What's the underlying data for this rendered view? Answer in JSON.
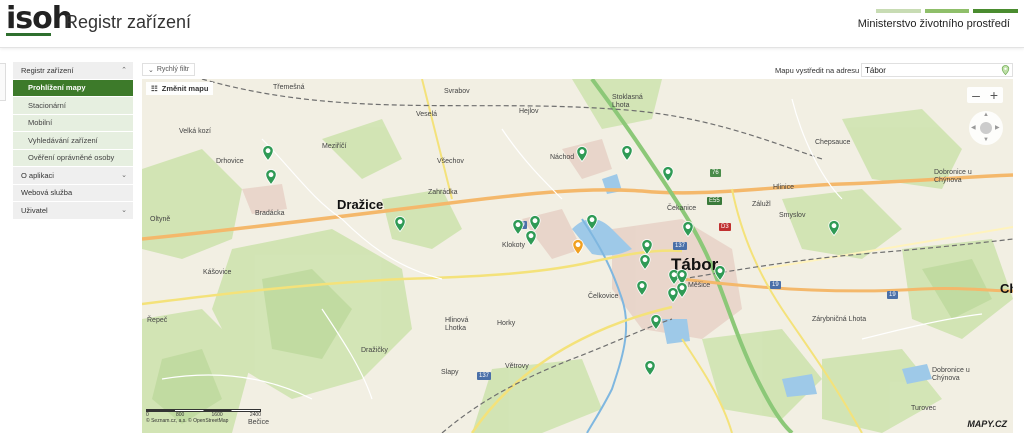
{
  "header": {
    "logo": "isoh",
    "title": "Registr zařízení",
    "ministry": "Ministerstvo životního prostředí",
    "ministry_bar_colors": [
      "#c8dcb4",
      "#8fbf6a",
      "#4a8c2f"
    ]
  },
  "sidebar": {
    "section_registr": "Registr zařízení",
    "sub_items": [
      {
        "label": "Prohlížení mapy",
        "active": true
      },
      {
        "label": "Stacionární"
      },
      {
        "label": "Mobilní"
      },
      {
        "label": "Vyhledávání zařízení"
      },
      {
        "label": "Ověření oprávněné osoby"
      }
    ],
    "about": "O aplikaci",
    "webservice": "Webová služba",
    "user": "Uživatel"
  },
  "toolbar": {
    "quick_filter": "Rychlý filtr",
    "center_label": "Mapu vystředit na adresu",
    "address_value": "Tábor",
    "change_map": "Změnit mapu"
  },
  "map": {
    "labels": {
      "tremesna": "Třemešná",
      "svrabov": "Svrabov",
      "stoklasna": "Stoklasná Lhota",
      "vesela": "Veselá",
      "hejlov": "Hejlov",
      "velkakoze": "Velká kozí",
      "drhovice": "Drhovice",
      "mezirici": "Meziříčí",
      "vsechov": "Všechov",
      "nachod": "Náchod",
      "zahradka": "Zahrádka",
      "hlinice": "Hlinice",
      "chepsauce": "Chepsauce",
      "dobrovice": "Dobronice u Chýnova",
      "drazice": "Dražice",
      "cekanice": "Čekanice",
      "zaluzi": "Zálužl",
      "smyslov": "Smyslov",
      "klokoty": "Klokoty",
      "oltyne": "Oltyně",
      "bradacka": "Bradácka",
      "kasovice": "Kášovice",
      "tabor": "Tábor",
      "celkovice": "Čelkovice",
      "mesice": "Měšice",
      "repec": "Řepeč",
      "hlinova": "Hlinová Lhotka",
      "horky": "Horky",
      "drazicky": "Dražičky",
      "slapy": "Slapy",
      "vetrovy": "Větrovy",
      "zarybnicna": "Zárybničná Lhota",
      "turovec": "Turovec",
      "becice": "Bečice",
      "chynov": "Dobronice u Chýnova",
      "ch": "Ch"
    },
    "road_numbers": {
      "r76": "76",
      "e55": "E55",
      "d3": "D3",
      "r137a": "137",
      "r137b": "137",
      "r19a": "19",
      "r19b": "19",
      "r19c": "19",
      "r193": "19"
    },
    "scale_labels": [
      "0",
      "800",
      "1600",
      "2400"
    ],
    "attribution": "© Seznam.cz, a.s. © OpenStreetMap",
    "provider": "MAPY.CZ"
  }
}
